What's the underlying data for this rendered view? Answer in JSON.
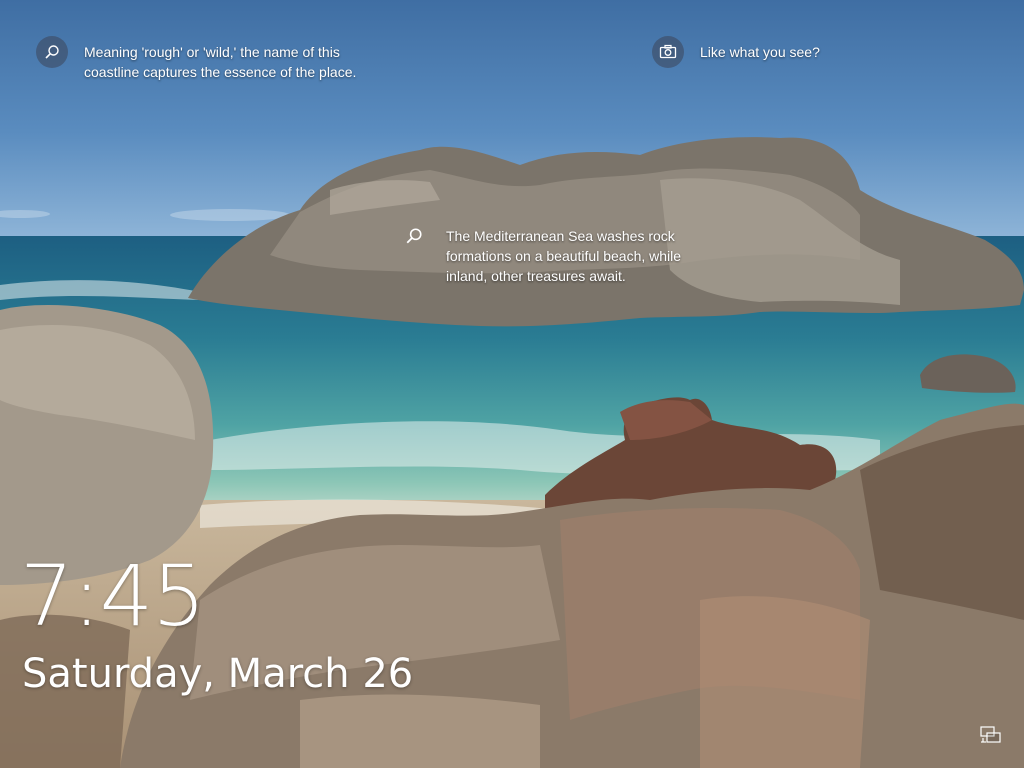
{
  "lockscreen": {
    "clock": {
      "time": "7:45",
      "date": "Saturday, March 26"
    },
    "spotlight": {
      "coast_fact": "Meaning 'rough' or 'wild,' the name of this coastline captures the essence of the place.",
      "like_prompt": "Like what you see?",
      "sea_fact": "The Mediterranean Sea washes rock formations on a beautiful beach, while inland, other treasures await."
    },
    "icons": {
      "coast_fact": "search-icon",
      "like_prompt": "camera-icon",
      "sea_fact": "search-icon",
      "network": "network-icon"
    }
  }
}
